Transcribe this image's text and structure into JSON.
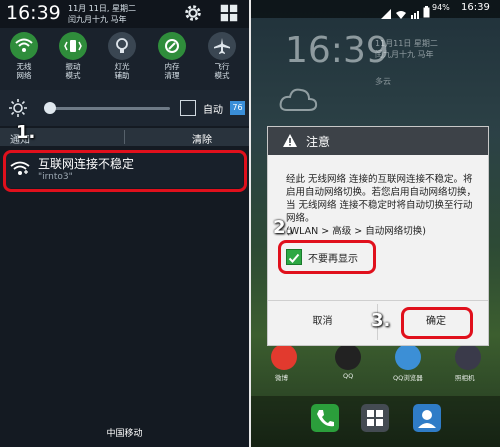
{
  "left": {
    "status_time": "16:39",
    "status_date": "11月 11日, 星期二\n闰九月十九 马年",
    "quick_settings": [
      {
        "label": "无线\n网络",
        "icon": "wifi-icon",
        "state": "on"
      },
      {
        "label": "振动\n模式",
        "icon": "vibrate-icon",
        "state": "on"
      },
      {
        "label": "灯光\n辅助",
        "icon": "flashlight-icon",
        "state": "off"
      },
      {
        "label": "内存\n清理",
        "icon": "memory-clean-icon",
        "state": "on"
      },
      {
        "label": "飞行\n模式",
        "icon": "airplane-icon",
        "state": "off"
      }
    ],
    "brightness": {
      "level": 0.03,
      "auto_label": "自动",
      "auto_value": "76"
    },
    "notification_header": {
      "label": "通知",
      "clear_label": "清除"
    },
    "notification": {
      "title": "互联网连接不稳定",
      "subtitle": "\"irnto3\"",
      "icon": "wifi-warning-icon"
    },
    "step1": "1.",
    "carrier": "中国移动"
  },
  "right": {
    "battery": "94%",
    "status_time": "16:39",
    "clock": "16:39",
    "date": "11月11日 星期二\n闰九月十九 马年",
    "weather": "多云",
    "dialog": {
      "title": "注意",
      "body": "经此 无线网络 连接的互联网连接不稳定。将启用自动网络切换。若您启用自动网络切换，当 无线网络 连接不稳定时将自动切换至行动网络。\n(WLAN > 高级 > 自动网络切换)",
      "checkbox_label": "不要再显示",
      "checkbox_checked": true,
      "cancel_label": "取消",
      "ok_label": "确定"
    },
    "step2": "2.",
    "step3": "3.",
    "apps": [
      {
        "label": "微博",
        "color": "#e23a2e"
      },
      {
        "label": "QQ",
        "color": "#222222"
      },
      {
        "label": "QQ浏览器",
        "color": "#3c8fd6"
      },
      {
        "label": "照相机",
        "color": "#3a3a4a"
      }
    ],
    "dock_icons": [
      {
        "icon": "phone-icon",
        "color": "#2b9e3b"
      },
      {
        "icon": "apps-grid-icon",
        "color": "#444b52"
      },
      {
        "icon": "contacts-icon",
        "color": "#2f7cc7"
      }
    ]
  },
  "colors": {
    "highlight": "#e0101c",
    "accent_green": "#2f8d3b",
    "checkbox_green": "#2ea844"
  }
}
